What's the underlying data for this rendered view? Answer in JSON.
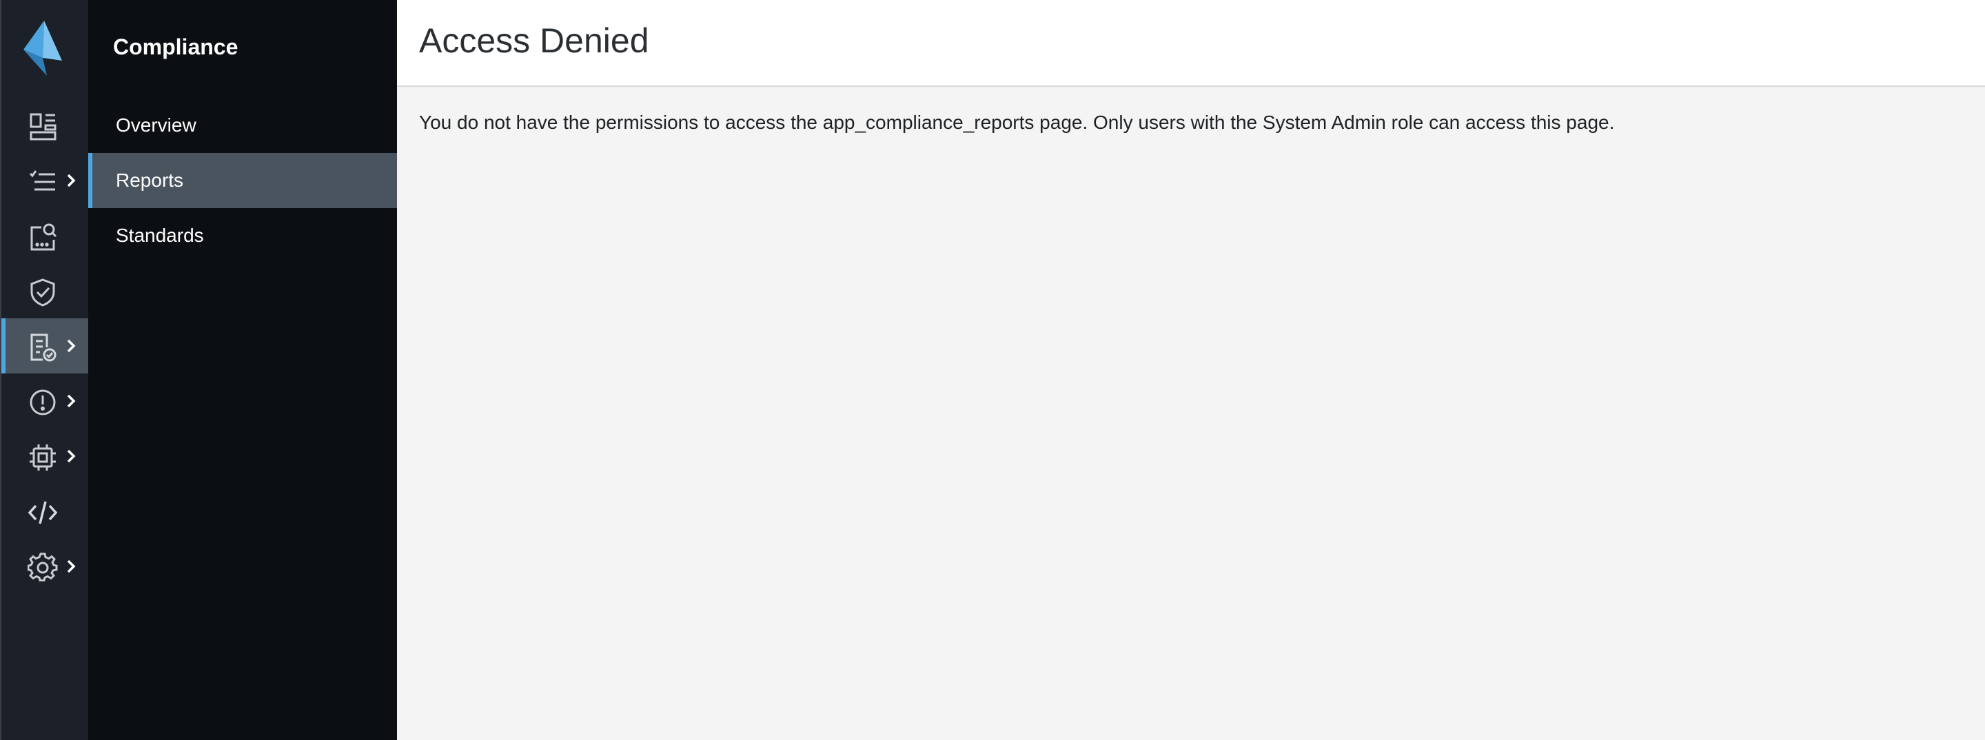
{
  "app": {
    "logo_icon": "app-logo-icon",
    "accent_color": "#4ea6e0"
  },
  "rail": {
    "items": [
      {
        "name": "dashboard",
        "icon": "dashboard-icon",
        "has_submenu": false
      },
      {
        "name": "checklist",
        "icon": "checklist-icon",
        "has_submenu": true
      },
      {
        "name": "search-report",
        "icon": "search-report-icon",
        "has_submenu": false
      },
      {
        "name": "shield",
        "icon": "shield-check-icon",
        "has_submenu": false
      },
      {
        "name": "compliance",
        "icon": "compliance-report-icon",
        "has_submenu": true,
        "active": true
      },
      {
        "name": "alerts",
        "icon": "alert-icon",
        "has_submenu": true
      },
      {
        "name": "platform",
        "icon": "chip-icon",
        "has_submenu": true
      },
      {
        "name": "code",
        "icon": "code-icon",
        "has_submenu": false
      },
      {
        "name": "settings",
        "icon": "gear-icon",
        "has_submenu": true
      }
    ]
  },
  "subnav": {
    "title": "Compliance",
    "items": [
      {
        "label": "Overview"
      },
      {
        "label": "Reports",
        "active": true
      },
      {
        "label": "Standards"
      }
    ]
  },
  "main": {
    "title": "Access Denied",
    "message": "You do not have the permissions to access the app_compliance_reports page. Only users with the System Admin role can access this page."
  }
}
